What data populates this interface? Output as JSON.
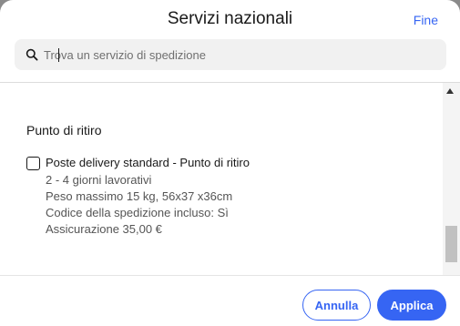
{
  "header": {
    "title": "Servizi nazionali",
    "done_label": "Fine"
  },
  "search": {
    "placeholder": "Trova un servizio di spedizione",
    "value": ""
  },
  "section": {
    "title": "Punto di ritiro",
    "option": {
      "title": "Poste delivery standard - Punto di ritiro",
      "checked": false,
      "details": [
        "2 - 4 giorni lavorativi",
        "Peso massimo 15 kg, 56x37 x36cm",
        "Codice della spedizione incluso: Sì",
        "Assicurazione 35,00 €"
      ]
    }
  },
  "footer": {
    "cancel_label": "Annulla",
    "apply_label": "Applica"
  },
  "colors": {
    "accent": "#3665f3",
    "text": "#191919",
    "secondary_text": "#555555"
  },
  "icons": {
    "search": "search-icon",
    "scroll_up": "arrow-up-icon"
  }
}
